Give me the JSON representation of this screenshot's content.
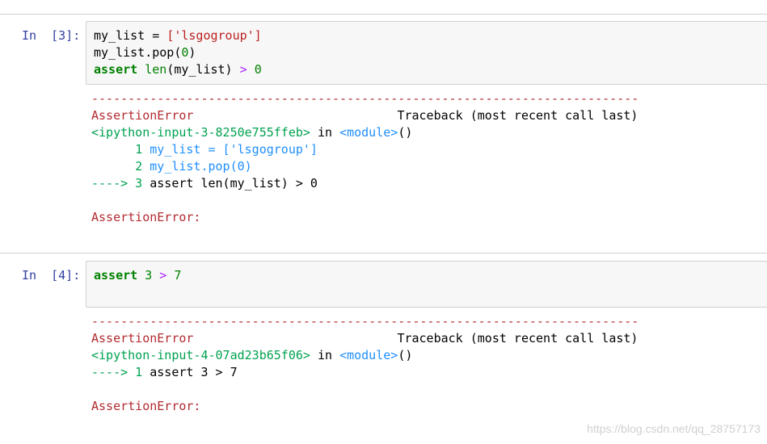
{
  "cells": [
    {
      "prompt": "In  [3]:",
      "input": {
        "line1": {
          "var": "my_list",
          "eq": " = ",
          "open": "['",
          "str": "lsgogroup",
          "close": "']"
        },
        "line2": {
          "text_a": "my_list.pop(",
          "num": "0",
          "text_b": ")"
        },
        "line3": {
          "kw": "assert",
          "sp": " ",
          "builtin": "len",
          "args": "(my_list)",
          "op": " > ",
          "num": "0"
        }
      },
      "output": {
        "dashes": "---------------------------------------------------------------------------",
        "error_name": "AssertionError",
        "traceback_label": "Traceback (most recent call last)",
        "location_file": "<ipython-input-3-8250e755ffeb>",
        "location_in": " in ",
        "location_module": "<module>",
        "location_paren": "()",
        "tb_lines": [
          {
            "arrow": "      ",
            "lineno": "1",
            "code": " my_list = ['lsgogroup']"
          },
          {
            "arrow": "      ",
            "lineno": "2",
            "code": " my_list.pop(0)"
          },
          {
            "arrow": "---->",
            "lineno": " 3",
            "code": " assert len(my_list) > 0"
          }
        ],
        "final_error": "AssertionError:"
      }
    },
    {
      "prompt": "In  [4]:",
      "input": {
        "line1": {
          "kw": "assert",
          "sp": " ",
          "num_a": "3",
          "op": " > ",
          "num_b": "7"
        }
      },
      "output": {
        "dashes": "---------------------------------------------------------------------------",
        "error_name": "AssertionError",
        "traceback_label": "Traceback (most recent call last)",
        "location_file": "<ipython-input-4-07ad23b65f06>",
        "location_in": " in ",
        "location_module": "<module>",
        "location_paren": "()",
        "tb_lines": [
          {
            "arrow": "---->",
            "lineno": " 1",
            "code": " assert 3 > 7"
          }
        ],
        "final_error": "AssertionError:"
      }
    }
  ],
  "watermark": "https://blog.csdn.net/qq_28757173",
  "colors": {
    "prompt": "#303f9f",
    "keyword": "#008000",
    "string": "#ba2121",
    "operator": "#aa22ff",
    "traceback_red": "#b22b31",
    "traceback_green": "#00a250",
    "traceback_blue": "#208ffb"
  }
}
